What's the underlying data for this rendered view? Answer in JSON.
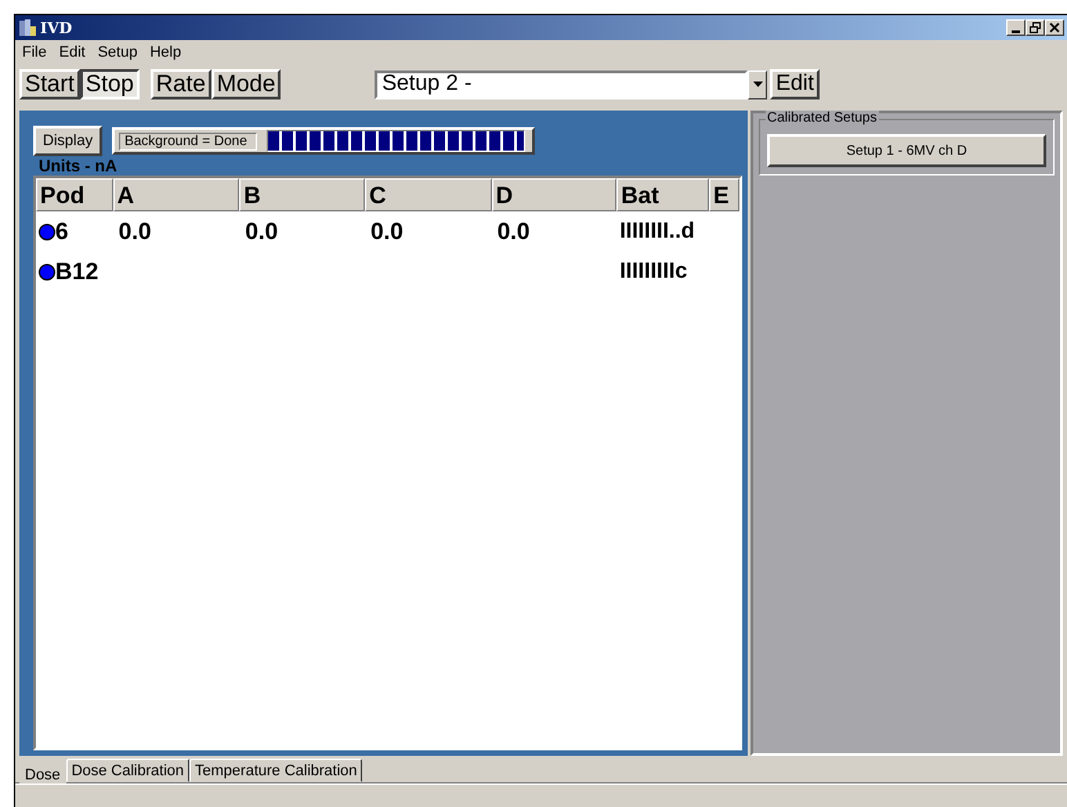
{
  "window": {
    "title": "IVD"
  },
  "menu": [
    "File",
    "Edit",
    "Setup",
    "Help"
  ],
  "toolbar": {
    "buttons": [
      {
        "label": "Start",
        "selected": false
      },
      {
        "label": "Stop",
        "selected": true
      },
      {
        "label": "Rate",
        "selected": false
      },
      {
        "label": "Mode",
        "selected": false
      }
    ],
    "setup_select": "Setup 2 -",
    "edit_button": "Edit"
  },
  "display_button": "Display",
  "status_text": "Background = Done",
  "progress": {
    "level": 1
  },
  "units": "Units - nA",
  "table": {
    "columns": [
      "Pod",
      "A",
      "B",
      "C",
      "D",
      "Bat",
      "E"
    ],
    "rows": [
      {
        "color": "#0000ff",
        "cells": [
          "6",
          "0.0",
          "0.0",
          "0.0",
          "0.0",
          "IIIIIIII..d",
          ""
        ]
      },
      {
        "color": "#0000ff",
        "cells": [
          "B12",
          "",
          "",
          "",
          "",
          "IIIIIIIIIc",
          ""
        ]
      }
    ]
  },
  "calibrated_setups": {
    "title": "Calibrated Setups",
    "items": [
      "Setup 1 - 6MV ch D"
    ]
  },
  "tabs": [
    {
      "label": "Dose",
      "selected": true
    },
    {
      "label": "Dose Calibration",
      "selected": false
    },
    {
      "label": "Temperature Calibration",
      "selected": false
    }
  ]
}
